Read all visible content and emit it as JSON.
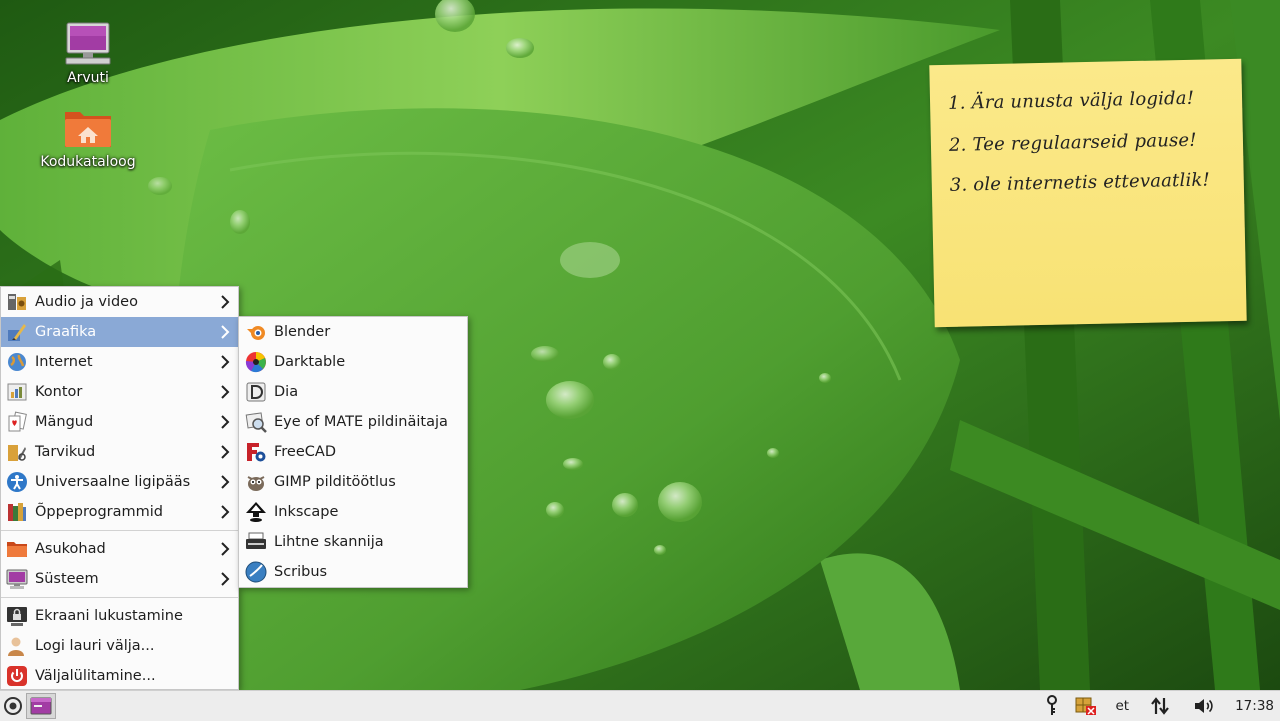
{
  "desktop": {
    "icons": [
      {
        "label": "Arvuti",
        "icon": "computer-icon"
      },
      {
        "label": "Kodukataloog",
        "icon": "home-folder-icon"
      }
    ]
  },
  "sticky_note": {
    "lines": [
      "1. Ära unusta välja logida!",
      "2. Tee regulaarseid pause!",
      "3. ole internetis ettevaatlik!"
    ]
  },
  "main_menu": {
    "categories": [
      {
        "label": "Audio ja video",
        "icon": "audio-video-icon",
        "active": false
      },
      {
        "label": "Graafika",
        "icon": "graphics-icon",
        "active": true
      },
      {
        "label": "Internet",
        "icon": "internet-globe-icon",
        "active": false
      },
      {
        "label": "Kontor",
        "icon": "office-icon",
        "active": false
      },
      {
        "label": "Mängud",
        "icon": "games-cards-icon",
        "active": false
      },
      {
        "label": "Tarvikud",
        "icon": "accessories-icon",
        "active": false
      },
      {
        "label": "Universaalne ligipääs",
        "icon": "accessibility-icon",
        "active": false
      },
      {
        "label": "Õppeprogrammid",
        "icon": "education-icon",
        "active": false
      }
    ],
    "places": [
      {
        "label": "Asukohad",
        "icon": "places-folder-icon"
      },
      {
        "label": "Süsteem",
        "icon": "system-monitor-icon"
      }
    ],
    "session": [
      {
        "label": "Ekraani lukustamine",
        "icon": "lock-screen-icon"
      },
      {
        "label": "Logi lauri välja...",
        "icon": "logout-user-icon"
      },
      {
        "label": "Väljalülitamine...",
        "icon": "power-icon"
      }
    ]
  },
  "submenu": {
    "items": [
      {
        "label": "Blender",
        "icon": "blender-icon"
      },
      {
        "label": "Darktable",
        "icon": "darktable-icon"
      },
      {
        "label": "Dia",
        "icon": "dia-icon"
      },
      {
        "label": "Eye of MATE pildinäitaja",
        "icon": "image-viewer-icon"
      },
      {
        "label": "FreeCAD",
        "icon": "freecad-icon"
      },
      {
        "label": "GIMP pilditöötlus",
        "icon": "gimp-icon"
      },
      {
        "label": "Inkscape",
        "icon": "inkscape-icon"
      },
      {
        "label": "Lihtne skannija",
        "icon": "scanner-icon"
      },
      {
        "label": "Scribus",
        "icon": "scribus-icon"
      }
    ]
  },
  "panel": {
    "keyboard_layout": "et",
    "clock": "17:38"
  },
  "colors": {
    "menu_highlight": "#8aa9d6",
    "panel_bg": "#ededed",
    "note_yellow": "#f8e274"
  }
}
